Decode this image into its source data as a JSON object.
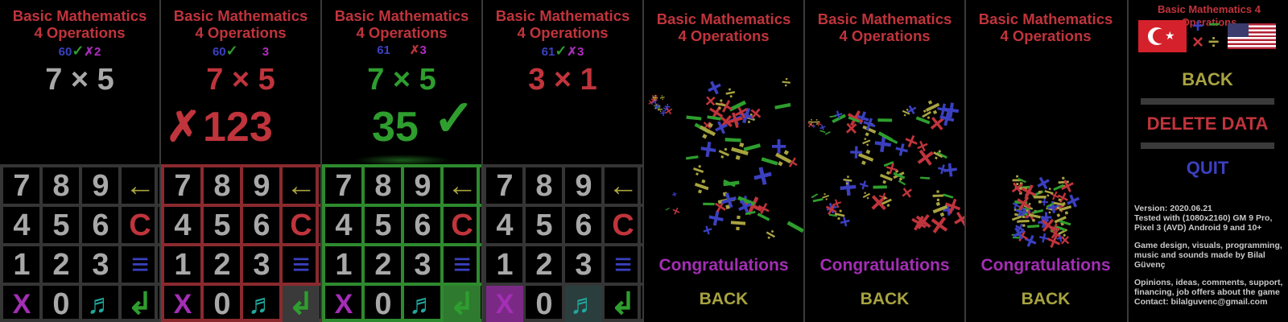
{
  "title": "Basic Mathematics",
  "subtitle": "4 Operations",
  "keys": [
    "7",
    "8",
    "9",
    "←",
    "4",
    "5",
    "6",
    "C",
    "1",
    "2",
    "3",
    "≡",
    "X",
    "0",
    "♬",
    "↲"
  ],
  "colors": {
    "red": "#c0343c",
    "blue": "#3b40c0",
    "green": "#2e9e2e",
    "purple": "#a42eb5",
    "olive": "#a8a340",
    "teal": "#21a89c",
    "gray": "#a8a8a8"
  },
  "screens": [
    {
      "correct": "60",
      "wrong": "2",
      "question": "7 × 5",
      "answer": ""
    },
    {
      "correct": "60",
      "wrong": "3",
      "question": "7 × 5",
      "answer": "123",
      "mark": "✗"
    },
    {
      "correct": "61",
      "wrong": "3",
      "question": "7 × 5",
      "answer": "35",
      "mark": "✓"
    },
    {
      "correct": "61",
      "wrong": "3",
      "question": "3 × 1",
      "answer": ""
    }
  ],
  "end_screens": [
    {
      "message": "Congratulations",
      "back": "BACK"
    },
    {
      "message": "Congratulations",
      "back": "BACK"
    },
    {
      "message": "Congratulations",
      "back": "BACK"
    }
  ],
  "menu": {
    "title": "Basic Mathematics 4 Operations",
    "back": "BACK",
    "delete": "DELETE DATA",
    "quit": "QUIT",
    "flags": [
      "turkey-flag",
      "operations-logo",
      "usa-flag"
    ]
  },
  "info": {
    "version": "Version: 2020.06.21",
    "tested": "Tested with (1080x2160) GM 9 Pro, Pixel 3 (AVD) Android 9 and 10+",
    "credits": "Game design, visuals, programming, music and sounds made by Bilal Güvenç",
    "contact": "Opinions, ideas, comments, support, financing, job offers about the game Contact: bilalguvenc@gmail.com"
  },
  "icons": [
    "check-icon",
    "cross-icon",
    "backspace-icon",
    "clear-icon",
    "menu-icon",
    "close-icon",
    "music-icon",
    "enter-icon"
  ]
}
